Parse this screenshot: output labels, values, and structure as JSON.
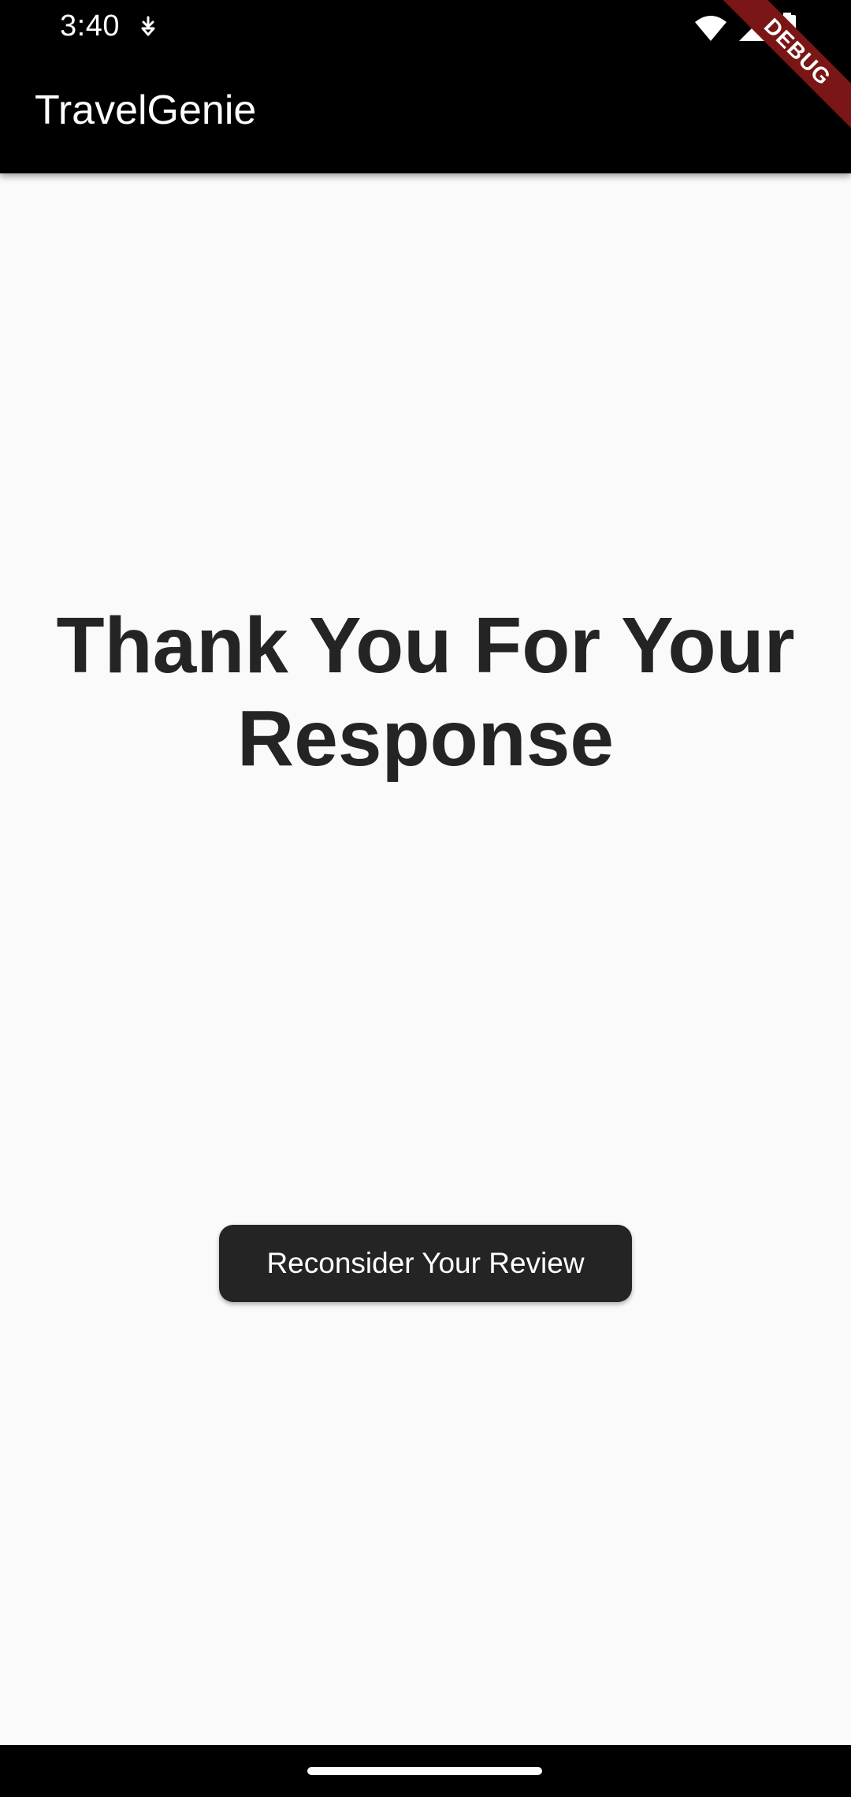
{
  "status_bar": {
    "time": "3:40",
    "icons": [
      "app-notification-icon",
      "wifi-icon",
      "signal-icon",
      "battery-icon"
    ]
  },
  "app_bar": {
    "title": "TravelGenie"
  },
  "debug_banner": {
    "label": "DEBUG"
  },
  "main": {
    "message": "Thank You For Your Response",
    "reconsider_button_label": "Reconsider Your Review"
  },
  "colors": {
    "background": "#fafafa",
    "app_bar": "#000000",
    "text_primary": "#242424",
    "button_bg": "#242424",
    "button_text": "#ffffff",
    "debug_banner": "#7b1616"
  }
}
